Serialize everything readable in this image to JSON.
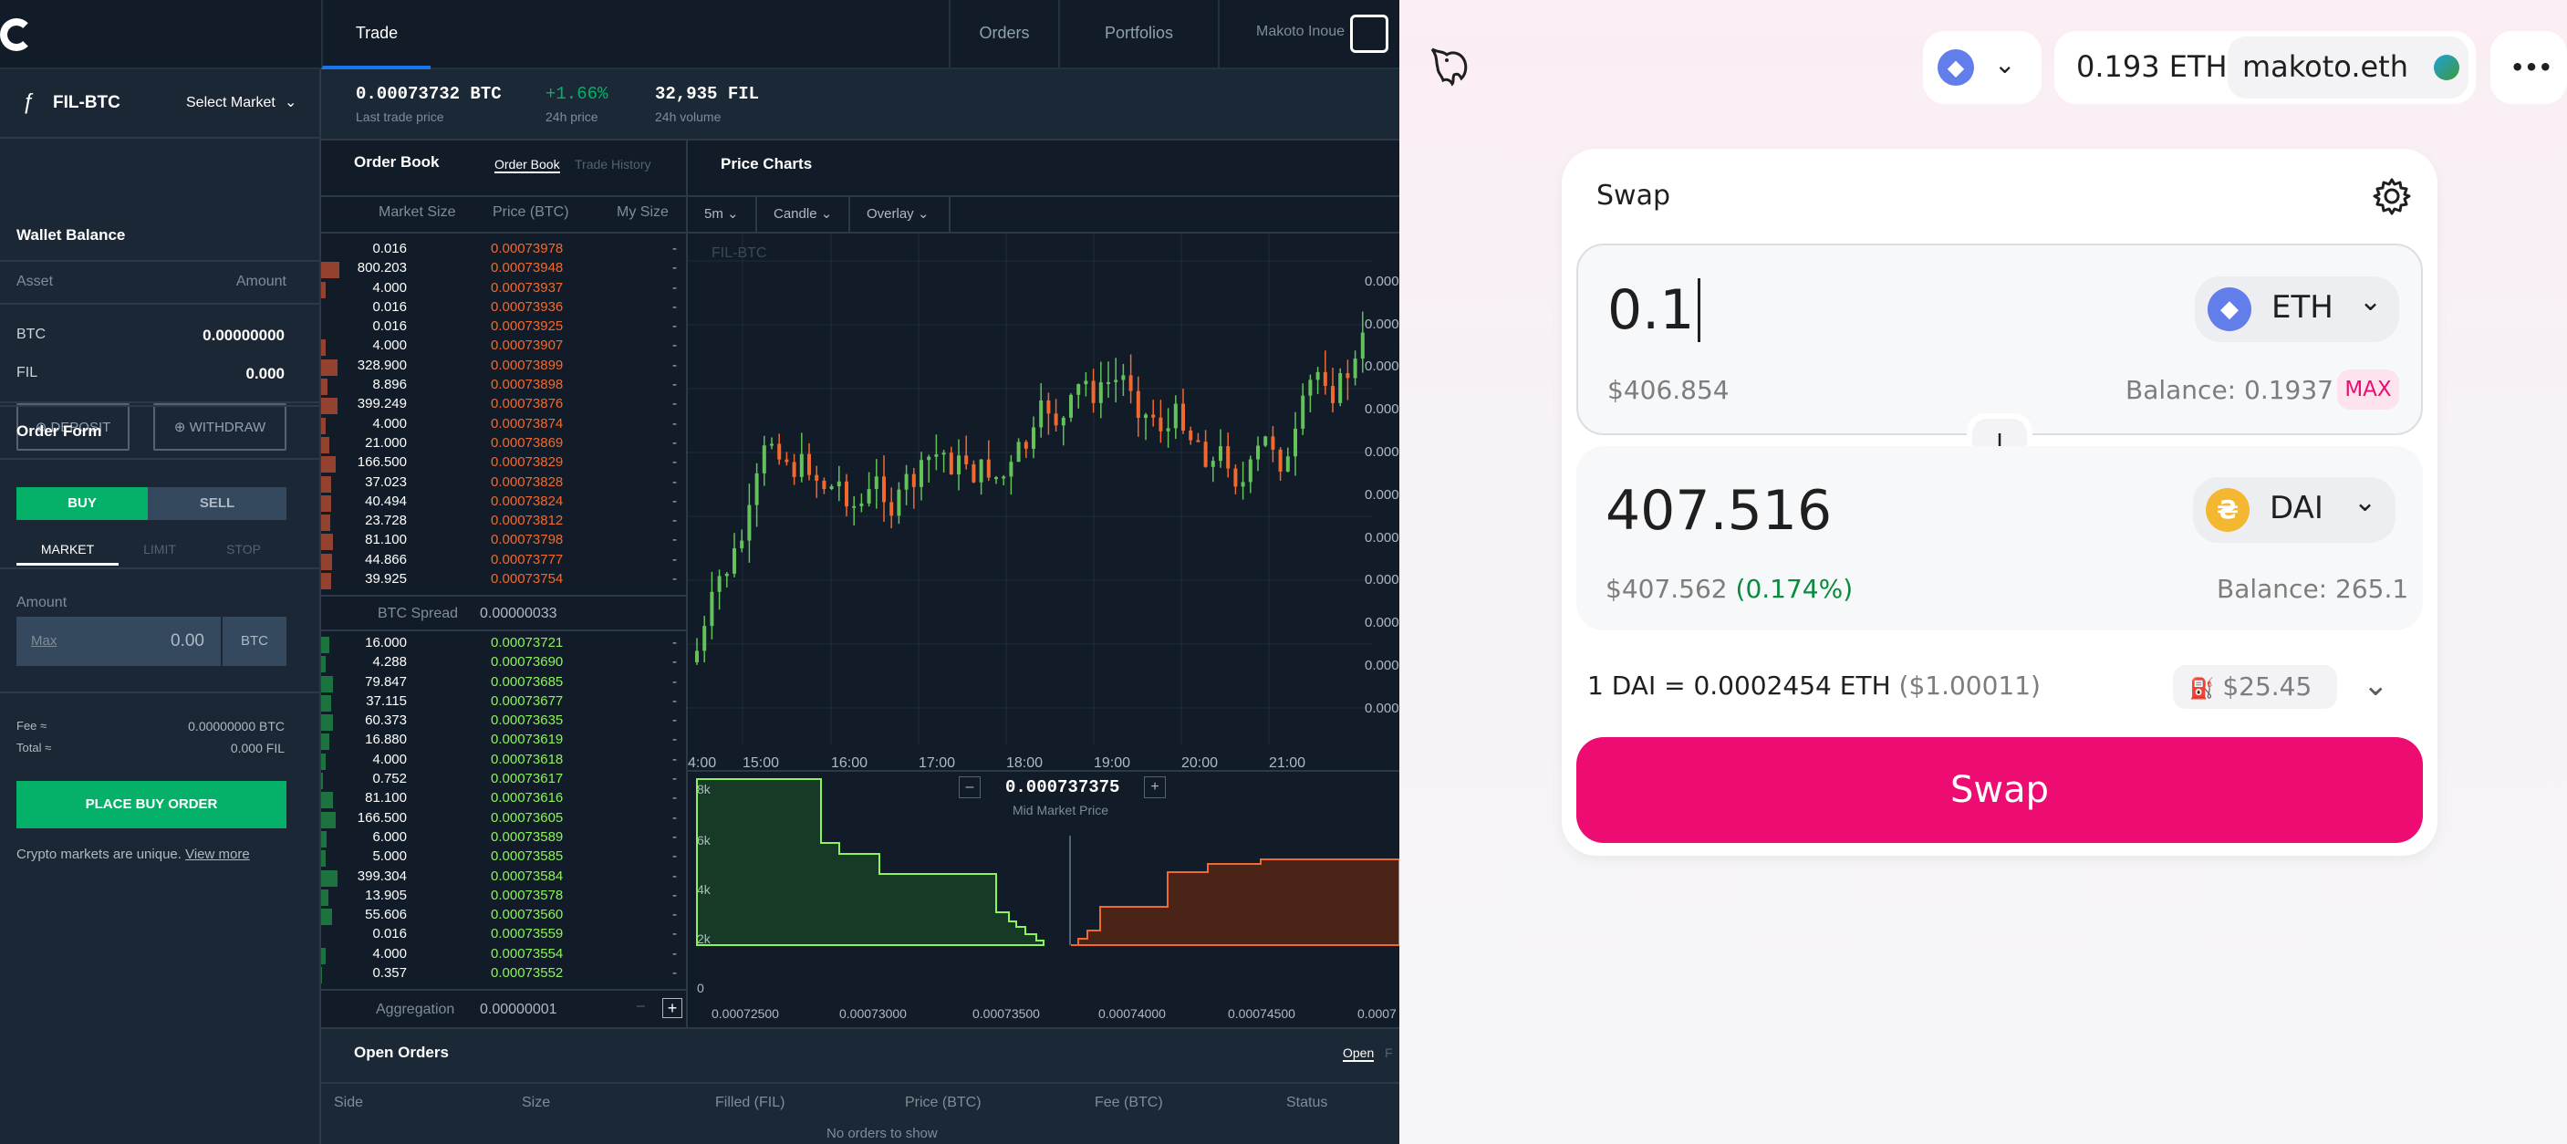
{
  "coinbase": {
    "nav": {
      "trade": "Trade",
      "orders": "Orders",
      "portfolios": "Portfolios",
      "user": "Makoto Inoue"
    },
    "market": {
      "pair": "FIL-BTC",
      "select": "Select Market",
      "last_price": "0.00073732 BTC",
      "last_price_label": "Last trade price",
      "change": "+1.66%",
      "change_label": "24h price",
      "volume": "32,935 FIL",
      "volume_label": "24h volume"
    },
    "wallet": {
      "title": "Wallet Balance",
      "col_asset": "Asset",
      "col_amount": "Amount",
      "rows": [
        {
          "asset": "BTC",
          "amount": "0.00000000"
        },
        {
          "asset": "FIL",
          "amount": "0.000"
        }
      ],
      "deposit": "DEPOSIT",
      "withdraw": "WITHDRAW"
    },
    "order_form": {
      "title": "Order Form",
      "buy": "BUY",
      "sell": "SELL",
      "market": "MARKET",
      "limit": "LIMIT",
      "stop": "STOP",
      "amount_label": "Amount",
      "max": "Max",
      "amount_value": "0.00",
      "amount_unit": "BTC",
      "fee_label": "Fee ≈",
      "fee_value": "0.00000000 BTC",
      "total_label": "Total ≈",
      "total_value": "0.000 FIL",
      "place": "PLACE BUY ORDER",
      "note": "Crypto markets are unique.",
      "note_link": "View more"
    },
    "orderbook": {
      "title": "Order Book",
      "tab_book": "Order Book",
      "tab_history": "Trade History",
      "col_size": "Market Size",
      "col_price": "Price (BTC)",
      "col_my": "My Size",
      "spread_label": "BTC Spread",
      "spread_value": "0.00000033",
      "aggregation_label": "Aggregation",
      "aggregation_value": "0.00000001",
      "asks": [
        [
          "0.016",
          "0.00073978"
        ],
        [
          "800.203",
          "0.00073948"
        ],
        [
          "4.000",
          "0.00073937"
        ],
        [
          "0.016",
          "0.00073936"
        ],
        [
          "0.016",
          "0.00073925"
        ],
        [
          "4.000",
          "0.00073907"
        ],
        [
          "328.900",
          "0.00073899"
        ],
        [
          "8.896",
          "0.00073898"
        ],
        [
          "399.249",
          "0.00073876"
        ],
        [
          "4.000",
          "0.00073874"
        ],
        [
          "21.000",
          "0.00073869"
        ],
        [
          "166.500",
          "0.00073829"
        ],
        [
          "37.023",
          "0.00073828"
        ],
        [
          "40.494",
          "0.00073824"
        ],
        [
          "23.728",
          "0.00073812"
        ],
        [
          "81.100",
          "0.00073798"
        ],
        [
          "44.866",
          "0.00073777"
        ],
        [
          "39.925",
          "0.00073754"
        ]
      ],
      "bids": [
        [
          "16.000",
          "0.00073721"
        ],
        [
          "4.288",
          "0.00073690"
        ],
        [
          "79.847",
          "0.00073685"
        ],
        [
          "37.115",
          "0.00073677"
        ],
        [
          "60.373",
          "0.00073635"
        ],
        [
          "16.880",
          "0.00073619"
        ],
        [
          "4.000",
          "0.00073618"
        ],
        [
          "0.752",
          "0.00073617"
        ],
        [
          "81.100",
          "0.00073616"
        ],
        [
          "166.500",
          "0.00073605"
        ],
        [
          "6.000",
          "0.00073589"
        ],
        [
          "5.000",
          "0.00073585"
        ],
        [
          "399.304",
          "0.00073584"
        ],
        [
          "13.905",
          "0.00073578"
        ],
        [
          "55.606",
          "0.00073560"
        ],
        [
          "0.016",
          "0.00073559"
        ],
        [
          "4.000",
          "0.00073554"
        ],
        [
          "0.357",
          "0.00073552"
        ]
      ],
      "my_size": "-"
    },
    "chart": {
      "title": "Price Charts",
      "interval": "5m",
      "type": "Candle",
      "overlay": "Overlay",
      "watermark": "FIL-BTC",
      "time_ticks": [
        "4:00",
        "15:00",
        "16:00",
        "17:00",
        "18:00",
        "19:00",
        "20:00",
        "21:00"
      ],
      "mid_price": "0.000737375",
      "mid_label": "Mid Market Price",
      "depth_y": [
        "8k",
        "6k",
        "4k",
        "2k",
        "0"
      ],
      "depth_x": [
        "0.00072500",
        "0.00073000",
        "0.00073500",
        "0.00074000",
        "0.00074500",
        "0.0007"
      ]
    },
    "open_orders": {
      "title": "Open Orders",
      "tab_open": "Open",
      "tab_fills": "F",
      "cols": [
        "Side",
        "Size",
        "Filled (FIL)",
        "Price (BTC)",
        "Fee (BTC)",
        "Status"
      ],
      "empty": "No orders to show"
    }
  },
  "uniswap": {
    "header": {
      "eth_balance": "0.193 ETH",
      "account": "makoto.eth",
      "more": "•••"
    },
    "swap": {
      "title": "Swap",
      "input_amount": "0.1",
      "input_token": "ETH",
      "input_usd": "$406.854",
      "input_balance": "Balance: 0.1937",
      "max": "MAX",
      "output_amount": "407.516",
      "output_token": "DAI",
      "output_usd": "$407.562",
      "output_pct": "(0.174%)",
      "output_balance": "Balance: 265.1",
      "rate": "1 DAI = 0.0002454 ETH",
      "rate_usd": "($1.00011)",
      "gas": "$25.45",
      "button": "Swap"
    },
    "colors": {
      "accent": "#ed0c72",
      "eth": "#627eea",
      "dai": "#f4b731",
      "green": "#0a8a3c"
    }
  }
}
